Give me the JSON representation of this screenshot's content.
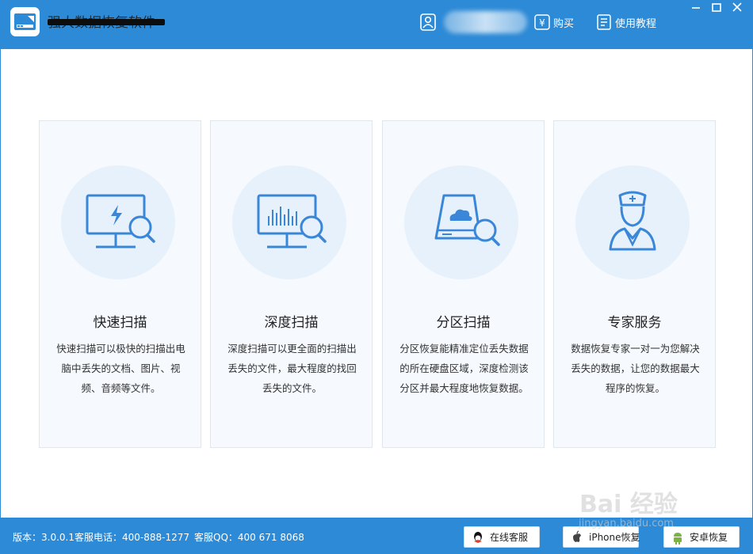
{
  "app": {
    "title": "强大数据恢复软件"
  },
  "header": {
    "buy_label": "购买",
    "tutorial_label": "使用教程"
  },
  "cards": [
    {
      "title": "快速扫描",
      "description": "快速扫描可以极快的扫描出电脑中丢失的文档、图片、视频、音频等文件。",
      "icon": "monitor-lightning-search-icon"
    },
    {
      "title": "深度扫描",
      "description": "深度扫描可以更全面的扫描出丢失的文件，最大程度的找回丢失的文件。",
      "icon": "monitor-chart-search-icon"
    },
    {
      "title": "分区扫描",
      "description": "分区恢复能精准定位丢失数据的所在硬盘区域，深度检测该分区并最大程度地恢复数据。",
      "icon": "disk-cloud-search-icon"
    },
    {
      "title": "专家服务",
      "description": "数据恢复专家一对一为您解决丢失的数据，让您的数据最大程序的恢复。",
      "icon": "doctor-icon"
    }
  ],
  "status": {
    "version": "版本：3.0.0.1",
    "phone": "客服电话：400-888-1277",
    "qq": "客服QQ：400 671 8068"
  },
  "footer_buttons": {
    "online_service": "在线客服",
    "iphone_recovery": "iPhone恢复",
    "android_recovery": "安卓恢复"
  },
  "watermark": {
    "brand": "Bai  经验",
    "url": "jingyan.baidu.com"
  },
  "colors": {
    "primary": "#2d8ad6",
    "icon_blue": "#3a86d8",
    "card_bg": "#f6f9fd",
    "circle_bg": "#e6f1fb"
  }
}
